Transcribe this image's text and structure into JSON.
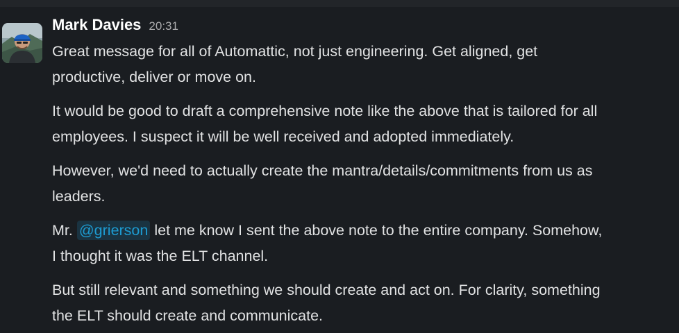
{
  "message": {
    "sender": "Mark Davies",
    "timestamp": "20:31",
    "paragraphs": [
      {
        "line1": "Great message for all of Automattic, not just engineering. Get aligned, get",
        "line2": "productive, deliver or move on."
      },
      {
        "line1": "It would be good to draft a comprehensive note like the above that is tailored for all",
        "line2": "employees. I suspect it will be well received and adopted immediately."
      },
      {
        "line1": "However, we'd need to actually create the mantra/details/commitments from us as",
        "line2": "leaders."
      },
      {
        "prefix": "Mr. ",
        "mention": "@grierson",
        "suffix": " let me know I sent the above note to the entire company. Somehow,",
        "line2": "I thought it was the ELT channel."
      },
      {
        "line1": "But still relevant and something we should create and act on. For clarity, something",
        "line2": "the ELT should create and communicate."
      }
    ]
  },
  "icons": {
    "avatar": "user-photo-avatar"
  },
  "colors": {
    "background": "#1a1d21",
    "text": "#e1e2e3",
    "sender": "#ffffff",
    "timestamp": "#ababad",
    "mention": "#1d9bd1"
  }
}
